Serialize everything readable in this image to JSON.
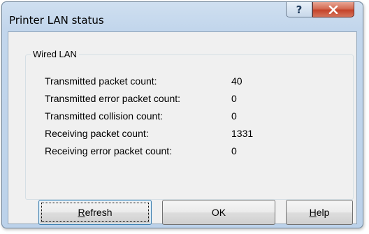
{
  "window": {
    "title": "Printer LAN status"
  },
  "titlebar_buttons": {
    "help_glyph": "?",
    "close_glyph": "✕"
  },
  "groupbox": {
    "label": "Wired LAN"
  },
  "stats": [
    {
      "label": "Transmitted packet count:",
      "value": "40"
    },
    {
      "label": "Transmitted error packet count:",
      "value": "0"
    },
    {
      "label": "Transmitted collision count:",
      "value": "0"
    },
    {
      "label": "Receiving packet count:",
      "value": "1331"
    },
    {
      "label": "Receiving error packet count:",
      "value": "0"
    }
  ],
  "buttons": {
    "refresh": {
      "mnemonic": "R",
      "rest": "efresh"
    },
    "ok": {
      "label": "OK"
    },
    "help": {
      "mnemonic": "H",
      "rest": "elp"
    }
  },
  "icons": {
    "help": "question-mark-icon",
    "close": "close-x-icon"
  },
  "colors": {
    "close_button": "#c4432a",
    "titlebar": "#c2d6ec",
    "client_background": "#f0f0f0"
  }
}
